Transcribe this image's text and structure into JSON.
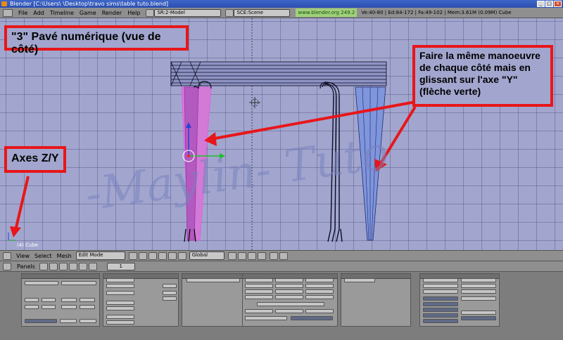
{
  "window": {
    "title": "Blender [C:\\Users\\       \\Desktop\\travo sims\\table tuto.blend]",
    "buttons": [
      "_",
      "□",
      "×"
    ]
  },
  "menu": {
    "items": [
      "File",
      "Add",
      "Timeline",
      "Game",
      "Render",
      "Help"
    ],
    "screen_field": "SR:2-Model",
    "scene_field": "SCE:Scene",
    "url": "www.blender.org 249.2",
    "stats": "Ve:40-80 | Ed:84-172 | Fa:49-102 | Mem:3.61M (0.09M) Cube"
  },
  "viewport": {
    "caption_top": "\"3\" Pavé numérique (vue de côté)",
    "caption_right": "Faire la même manoeuvre de chaque côté mais en glissant sur l'axe \"Y\" (flèche verte)",
    "caption_axes": "Axes Z/Y",
    "watermark": "-Maylin- Tuto",
    "object_label": "(4) Cube"
  },
  "toolbar": {
    "view": "View",
    "select": "Select",
    "mesh": "Mesh",
    "mode": "Edit Mode",
    "orientation": "Global"
  },
  "panels": {
    "label": "Panels",
    "page": "1"
  },
  "colors": {
    "viewport_bg": "#a2a6ce",
    "callout_border": "#e8161a",
    "selected_leg": "#d27ad6",
    "right_leg": "#7f95dc",
    "table_edges": "#0b0b20"
  }
}
